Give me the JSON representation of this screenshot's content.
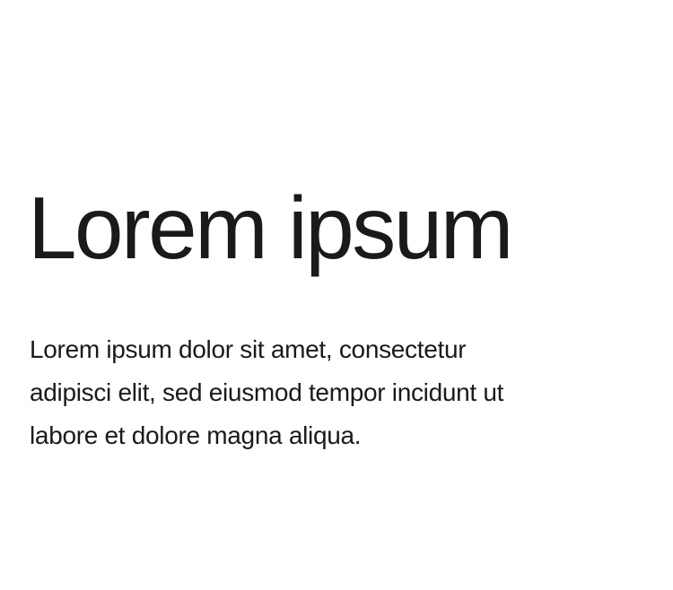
{
  "heading": "Lorem ipsum",
  "paragraph_lines": [
    "Lorem ipsum dolor sit amet, consectetur",
    "adipisci elit, sed eiusmod tempor incidunt ut",
    "labore et dolore magna aliqua."
  ]
}
